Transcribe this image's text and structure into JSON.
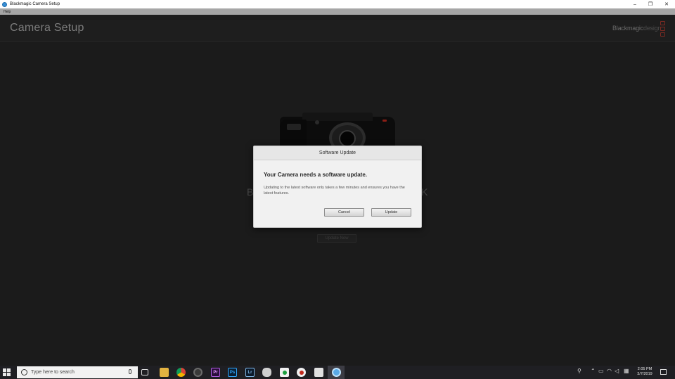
{
  "window": {
    "title": "Blackmagic Camera Setup",
    "controls": {
      "minimize": "–",
      "maximize": "❐",
      "close": "✕"
    }
  },
  "menu": {
    "items": [
      "Help"
    ]
  },
  "header": {
    "title": "Camera Setup",
    "brand_main": "Blackmagic",
    "brand_light": "design"
  },
  "main": {
    "background_text_left": "B",
    "background_text_right": "K",
    "update_now_label": "Update Now"
  },
  "dialog": {
    "title": "Software Update",
    "heading": "Your Camera needs a software update.",
    "body": "Updating to the latest software only takes a few minutes and ensures you have the latest features.",
    "cancel_label": "Cancel",
    "update_label": "Update"
  },
  "taskbar": {
    "search_placeholder": "Type here to search",
    "apps": [
      "task-view",
      "file-explorer",
      "chrome",
      "davinci-resolve",
      "premiere",
      "photoshop",
      "lightroom",
      "mixer",
      "green-app",
      "record-app",
      "calculator",
      "blackmagic-camera-setup"
    ],
    "premiere_label": "Pr",
    "photoshop_label": "Ps",
    "lightroom_label": "Lr",
    "time": "2:05 PM",
    "date": "3/7/2019"
  },
  "colors": {
    "background": "#1b1b1b",
    "dialog": "#f1f1f1",
    "brand_accent": "#7a2a22"
  }
}
